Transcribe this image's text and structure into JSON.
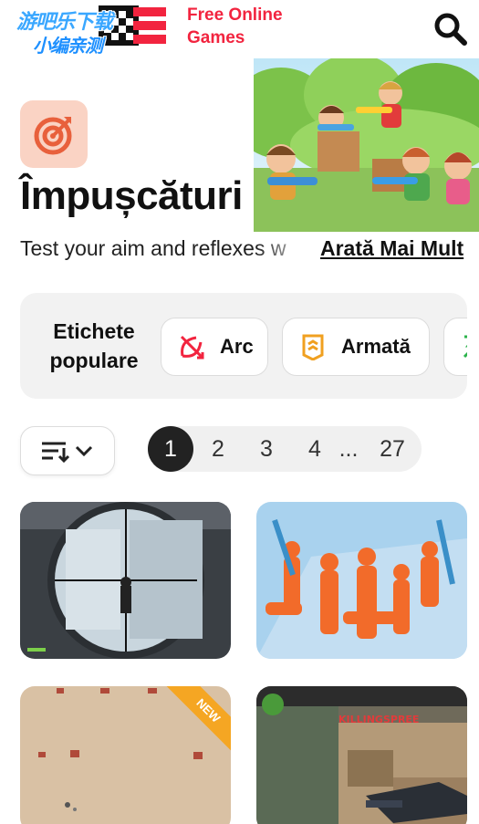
{
  "header": {
    "watermark_line1": "游吧乐下载",
    "watermark_line2": "小编亲测",
    "brand_line1": "Free Online",
    "brand_line2": "Games",
    "brand_color": "#f2243f"
  },
  "category": {
    "title": "Împușcături",
    "description": "Test your aim and reflexes w",
    "show_more_label": "Arată Mai Mult",
    "icon": "target-icon"
  },
  "tags": {
    "heading": "Etichete populare",
    "items": [
      {
        "label": "Arc",
        "icon": "bow-arrow-icon"
      },
      {
        "label": "Armată",
        "icon": "army-rank-icon"
      },
      {
        "label": "",
        "icon": "tag-icon"
      }
    ]
  },
  "sort": {
    "icon": "sort-icon"
  },
  "pagination": {
    "pages": [
      "1",
      "2",
      "3",
      "4",
      "...",
      "27"
    ],
    "current": "1"
  },
  "games": [
    {
      "name": "sniper-game",
      "badge": ""
    },
    {
      "name": "orange-ragdoll-game",
      "badge": ""
    },
    {
      "name": "top-down-shooter-game",
      "badge": "NEW"
    },
    {
      "name": "counter-strike-style-game",
      "badge": "",
      "hud_text": "KILLINGSPREE"
    }
  ]
}
